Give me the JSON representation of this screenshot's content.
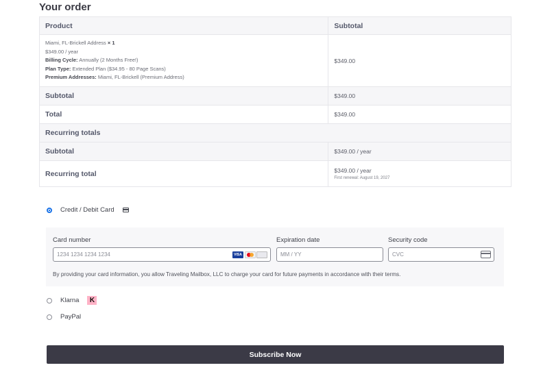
{
  "order": {
    "title": "Your order",
    "col_product": "Product",
    "col_subtotal": "Subtotal",
    "product": {
      "name": "Miami, FL-Brickell Address",
      "qty": "× 1",
      "price": "$349.00 / year",
      "billing_label": "Billing Cycle:",
      "billing_value": "Annually (2 Months Free!)",
      "plan_label": "Plan Type:",
      "plan_value": "Extended Plan ($34.95 - 80 Page Scans)",
      "premium_label": "Premium Addresses:",
      "premium_value": "Miami, FL-Brickell (Premium Address)",
      "line_subtotal": "$349.00"
    },
    "subtotal_label": "Subtotal",
    "subtotal_value": "$349.00",
    "total_label": "Total",
    "total_value": "$349.00",
    "recurring_label": "Recurring totals",
    "recurring_subtotal_label": "Subtotal",
    "recurring_subtotal_value": "$349.00 / year",
    "recurring_total_label": "Recurring total",
    "recurring_total_value": "$349.00 / year",
    "first_renewal": "First renewal: August 19, 2027"
  },
  "payment": {
    "card_option_label": "Credit / Debit Card",
    "card_selected": true,
    "card_number_label": "Card number",
    "card_number_placeholder": "1234 1234 1234 1234",
    "card_brand_visa": "VISA",
    "expiry_label": "Expiration date",
    "expiry_placeholder": "MM / YY",
    "cvc_label": "Security code",
    "cvc_placeholder": "CVC",
    "terms": "By providing your card information, you allow Traveling Mailbox, LLC to charge your card for future payments in accordance with their terms.",
    "klarna_label": "Klarna",
    "klarna_logo_text": "K",
    "paypal_label": "PayPal"
  },
  "subscribe_label": "Subscribe Now",
  "colors": {
    "accent_radio": "#1a73e8",
    "button_bg": "#3b3a46",
    "klarna_pink": "#ffb3c7"
  }
}
